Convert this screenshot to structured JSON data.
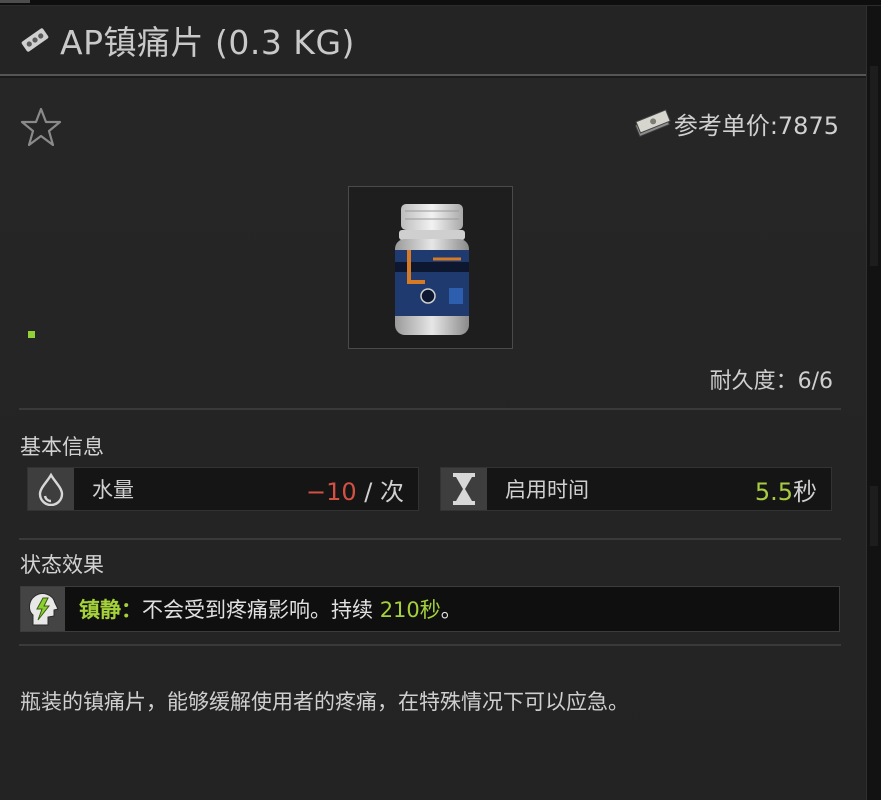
{
  "item": {
    "title": "AP镇痛片 (0.3 KG)",
    "price_label": "参考单价:7875",
    "durability": "耐久度：6/6"
  },
  "sections": {
    "basic_info": "基本信息",
    "status_effects": "状态效果"
  },
  "stats": [
    {
      "label": "水量",
      "value": "−10",
      "unit": " / 次",
      "icon": "water-drop-icon"
    },
    {
      "label": "启用时间",
      "value": "5.5",
      "unit": "秒",
      "icon": "hourglass-icon"
    }
  ],
  "effect": {
    "name": "镇静：",
    "text_before": "不会受到疼痛影响。持续 ",
    "duration": "210秒",
    "text_after": "。",
    "icon": "calm-head-icon"
  },
  "description": "瓶装的镇痛片，能够缓解使用者的疼痛，在特殊情况下可以应急。",
  "colors": {
    "negative": "#d35143",
    "positive": "#a7cc41",
    "effect_name": "#a5d13b",
    "background": "#262626"
  }
}
